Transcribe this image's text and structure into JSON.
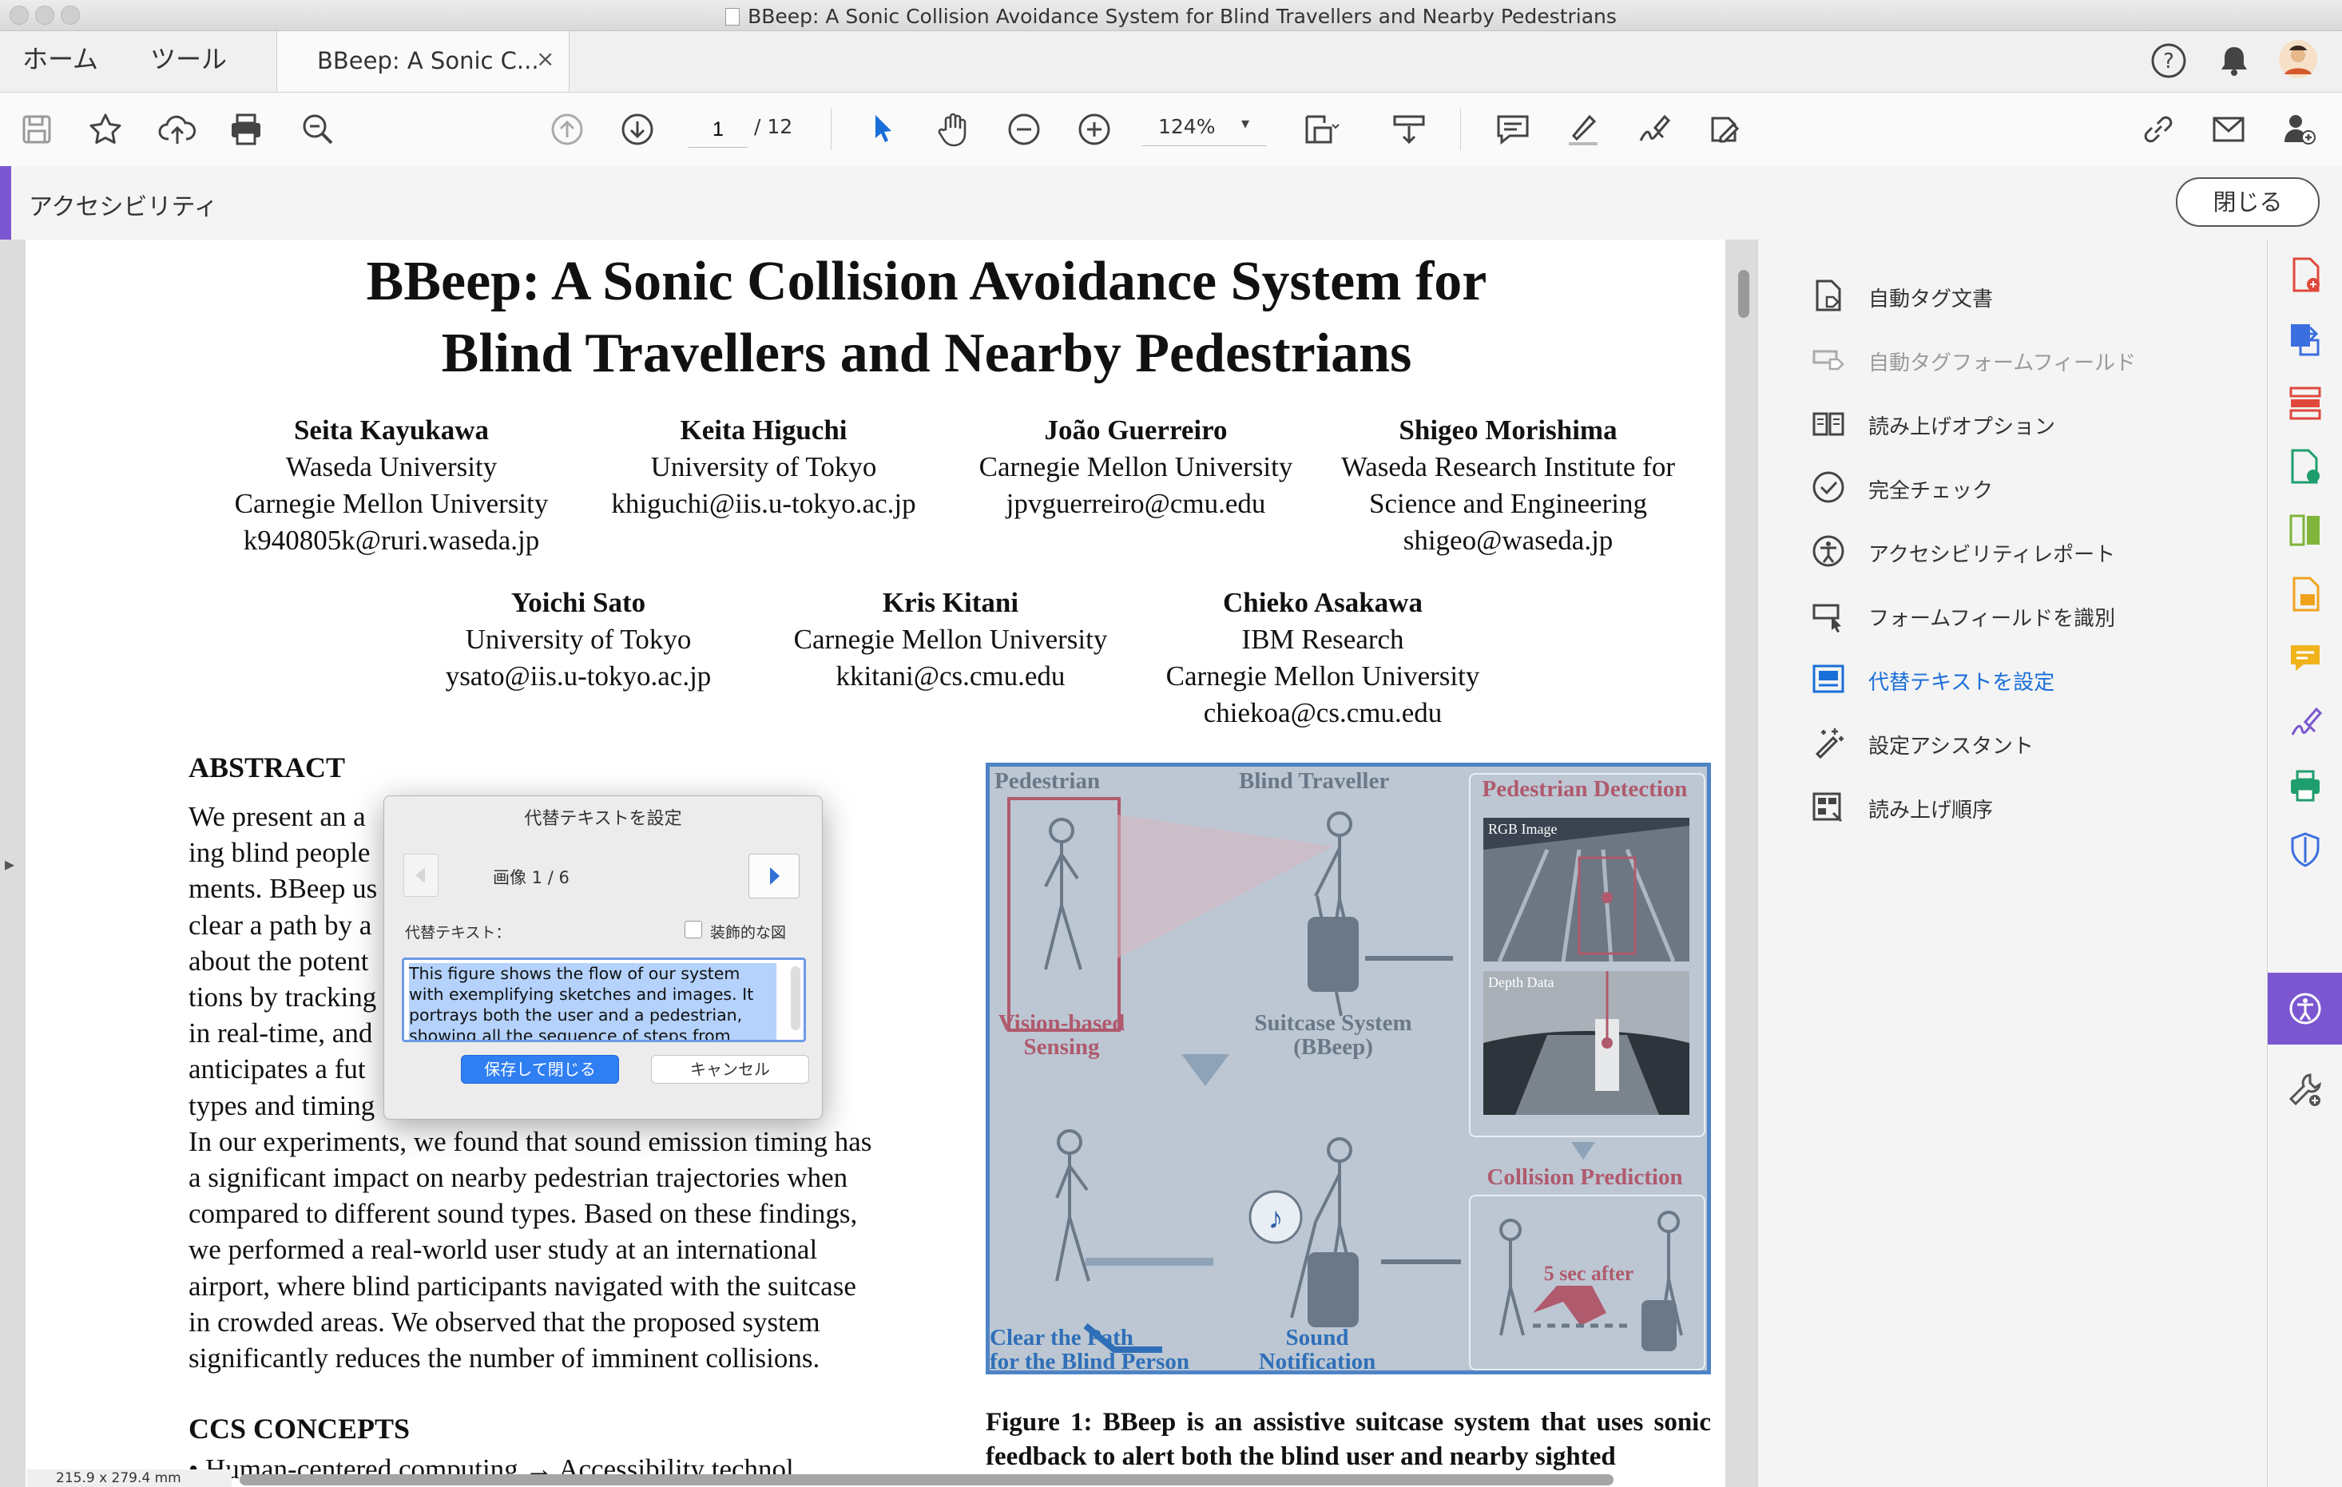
{
  "window": {
    "title": "BBeep: A Sonic Collision Avoidance System for Blind Travellers and Nearby Pedestrians"
  },
  "tabs": {
    "home": "ホーム",
    "tools": "ツール",
    "document": "BBeep: A Sonic C...",
    "close_symbol": "×"
  },
  "toolbar": {
    "page_current": "1",
    "page_total": "/ 12",
    "zoom": "124%",
    "zoom_caret": "▾",
    "icons": [
      "save-icon",
      "bookmark-star-icon",
      "upload-cloud-icon",
      "print-icon",
      "search-zoom-icon",
      "page-up-icon",
      "page-down-icon",
      "select-arrow-icon",
      "hand-icon",
      "zoom-out-icon",
      "zoom-in-icon",
      "fit-page-icon",
      "scroll-mode-icon",
      "comment-icon",
      "highlight-pen-icon",
      "sign-icon",
      "edit-icon",
      "link-icon",
      "email-icon",
      "add-user-icon"
    ]
  },
  "accessibility_bar": {
    "title": "アクセシビリティ",
    "close_label": "閉じる"
  },
  "paper": {
    "title_line1": "BBeep: A Sonic Collision Avoidance System for",
    "title_line2": "Blind Travellers and Nearby Pedestrians",
    "authors_row1": [
      {
        "name": "Seita Kayukawa",
        "lines": [
          "Waseda University",
          "Carnegie Mellon University",
          "k940805k@ruri.waseda.jp"
        ]
      },
      {
        "name": "Keita Higuchi",
        "lines": [
          "University of Tokyo",
          "khiguchi@iis.u-tokyo.ac.jp"
        ]
      },
      {
        "name": "João Guerreiro",
        "lines": [
          "Carnegie Mellon University",
          "jpvguerreiro@cmu.edu"
        ]
      },
      {
        "name": "Shigeo Morishima",
        "lines": [
          "Waseda Research Institute for",
          "Science and Engineering",
          "shigeo@waseda.jp"
        ]
      }
    ],
    "authors_row2": [
      {
        "name": "Yoichi Sato",
        "lines": [
          "University of Tokyo",
          "ysato@iis.u-tokyo.ac.jp"
        ]
      },
      {
        "name": "Kris Kitani",
        "lines": [
          "Carnegie Mellon University",
          "kkitani@cs.cmu.edu"
        ]
      },
      {
        "name": "Chieko Asakawa",
        "lines": [
          "IBM Research",
          "Carnegie Mellon University",
          "chiekoa@cs.cmu.edu"
        ]
      }
    ],
    "abstract_heading": "ABSTRACT",
    "abstract_lines": [
      "We present an a                                           support-",
      "ing blind people                                           environ-",
      "ments. BBeep us                                            to help",
      "clear a path by a                                          estrians",
      "about the potent                                           notifica-",
      "tions by tracking                                          position",
      "in real-time, and                                          when it",
      "anticipates a fut                                          ifferent",
      "types and timing                                           behavior.",
      "In our experiments, we found that sound emission timing has",
      "a significant impact on nearby pedestrian trajectories when",
      "compared to different sound types. Based on these findings,",
      "we performed a real-world user study at an international",
      "airport, where blind participants navigated with the suitcase",
      "in crowded areas. We observed that the proposed system",
      "significantly reduces the number of imminent collisions."
    ],
    "ccs_heading": "CCS CONCEPTS",
    "ccs_partial": "• Human-centered computing → Accessibility technol",
    "figure_caption": "Figure 1: BBeep is an assistive suitcase system that uses sonic feedback to alert both the blind user and nearby sighted"
  },
  "figure": {
    "labels": {
      "pedestrian": "Pedestrian",
      "blind_traveller": "Blind Traveller",
      "pedestrian_detection": "Pedestrian Detection",
      "rgb_image": "RGB Image",
      "depth_data": "Depth Data",
      "vision_sensing": "Vision-based\nSensing",
      "suitcase_system": "Suitcase System\n(BBeep)",
      "collision_prediction": "Collision Prediction",
      "five_sec": "5 sec after",
      "clear_path": "Clear the Path\nfor the Blind Person",
      "sound_notification": "Sound\nNotification"
    }
  },
  "dialog": {
    "title": "代替テキストを設定",
    "counter": "画像 1 / 6",
    "alt_label": "代替テキスト：",
    "decorative_label": "装飾的な図",
    "decorative_checked": false,
    "alt_text": "This figure shows the flow of our system with exemplifying sketches and images.  It portrays both the user and a pedestrian, showing all the sequence of steps from",
    "save_label": "保存して閉じる",
    "cancel_label": "キャンセル"
  },
  "tools_panel": {
    "items": [
      {
        "label": "自動タグ文書",
        "state": "normal",
        "icon": "auto-tag-document-icon"
      },
      {
        "label": "自動タグフォームフィールド",
        "state": "disabled",
        "icon": "auto-tag-form-field-icon"
      },
      {
        "label": "読み上げオプション",
        "state": "normal",
        "icon": "reading-options-icon"
      },
      {
        "label": "完全チェック",
        "state": "normal",
        "icon": "full-check-icon"
      },
      {
        "label": "アクセシビリティレポート",
        "state": "normal",
        "icon": "accessibility-report-icon"
      },
      {
        "label": "フォームフィールドを識別",
        "state": "normal",
        "icon": "identify-form-fields-icon"
      },
      {
        "label": "代替テキストを設定",
        "state": "active",
        "icon": "set-alt-text-icon"
      },
      {
        "label": "設定アシスタント",
        "state": "normal",
        "icon": "setup-assistant-icon"
      },
      {
        "label": "読み上げ順序",
        "state": "normal",
        "icon": "reading-order-icon"
      }
    ]
  },
  "rail": {
    "icons": [
      "create-pdf-icon",
      "export-pdf-icon",
      "organize-pages-icon",
      "edit-pdf-icon",
      "compare-icon",
      "combine-icon",
      "comment-rail-icon",
      "fill-sign-icon",
      "print-production-icon",
      "protect-icon",
      "accessibility-icon",
      "more-tools-icon"
    ],
    "colors": [
      "#e0483c",
      "#3b6fe0",
      "#e0483c",
      "#1f9e6d",
      "#7eb53a",
      "#f0a21c",
      "#f0b31c",
      "#7a57d1",
      "#1f9e6d",
      "#3b6fe0",
      "#ffffff",
      "#555555"
    ]
  },
  "status": {
    "page_size": "215.9 x 279.4 mm"
  },
  "colors": {
    "accent_purple": "#7a57d1",
    "primary_blue": "#2f7ef2",
    "figure_border": "#4e84c6"
  }
}
